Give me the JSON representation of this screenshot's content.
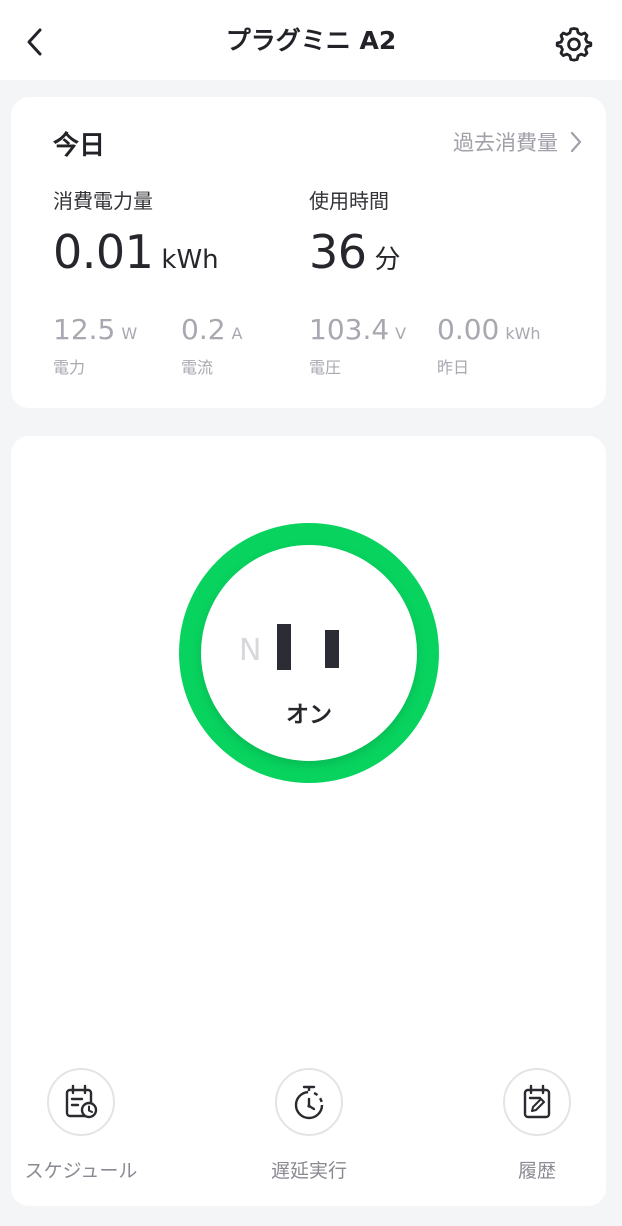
{
  "header": {
    "title": "プラグミニ A2"
  },
  "stats": {
    "today_label": "今日",
    "history_link": "過去消費量",
    "energy": {
      "label": "消費電力量",
      "value": "0.01",
      "unit": "kWh"
    },
    "usage_time": {
      "label": "使用時間",
      "value": "36",
      "unit": "分"
    },
    "details": [
      {
        "value": "12.5",
        "unit": "W",
        "label": "電力"
      },
      {
        "value": "0.2",
        "unit": "A",
        "label": "電流"
      },
      {
        "value": "103.4",
        "unit": "V",
        "label": "電圧"
      },
      {
        "value": "0.00",
        "unit": "kWh",
        "label": "昨日"
      }
    ]
  },
  "control": {
    "n_label": "N",
    "state": "オン",
    "ring_color": "#08d35f"
  },
  "actions": [
    {
      "label": "スケジュール",
      "icon": "calendar-clock-icon"
    },
    {
      "label": "遅延実行",
      "icon": "stopwatch-icon"
    },
    {
      "label": "履歴",
      "icon": "note-edit-icon"
    }
  ]
}
